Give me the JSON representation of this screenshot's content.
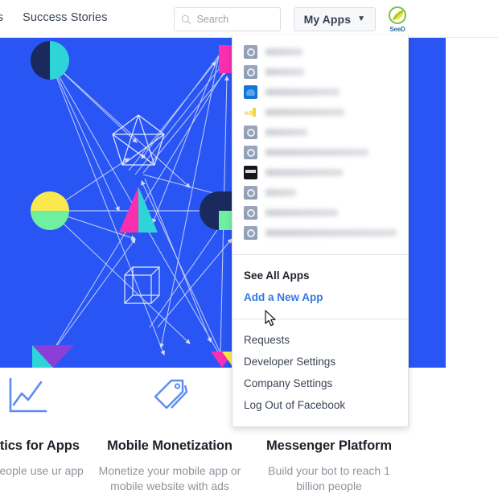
{
  "header": {
    "nav_links": [
      {
        "label": "ews",
        "name": "nav-link-news"
      },
      {
        "label": "Success Stories",
        "name": "nav-link-success-stories"
      }
    ],
    "search": {
      "placeholder": "Search",
      "value": "",
      "icon": "search-icon"
    },
    "my_apps": {
      "label": "My Apps",
      "caret": "▼"
    },
    "logo": {
      "text": "SeeD",
      "icon": "seed-leaf-logo"
    }
  },
  "dropdown": {
    "apps": [
      {
        "icon": "default-app-icon",
        "name_width": 46,
        "redacted": true
      },
      {
        "icon": "default-app-icon",
        "name_width": 48,
        "redacted": true
      },
      {
        "icon": "blue-app-icon",
        "name_width": 92,
        "redacted": true
      },
      {
        "icon": "edu-app-icon",
        "name_width": 98,
        "redacted": true
      },
      {
        "icon": "default-app-icon",
        "name_width": 52,
        "redacted": true
      },
      {
        "icon": "default-app-icon",
        "name_width": 128,
        "redacted": true
      },
      {
        "icon": "dark-app-icon",
        "name_width": 96,
        "redacted": true
      },
      {
        "icon": "default-app-icon",
        "name_width": 38,
        "redacted": true
      },
      {
        "icon": "default-app-icon",
        "name_width": 90,
        "redacted": true
      },
      {
        "icon": "default-app-icon",
        "name_width": 164,
        "redacted": true
      }
    ],
    "apps_section": [
      {
        "label": "See All Apps",
        "style": "strong",
        "name": "see-all-apps"
      },
      {
        "label": "Add a New App",
        "style": "link",
        "name": "add-a-new-app"
      }
    ],
    "account_section": [
      {
        "label": "Requests",
        "name": "requests"
      },
      {
        "label": "Developer Settings",
        "name": "developer-settings"
      },
      {
        "label": "Company Settings",
        "name": "company-settings"
      },
      {
        "label": "Log Out of Facebook",
        "name": "log-out-of-facebook"
      }
    ]
  },
  "hero": {
    "background_color": "#2a55f5",
    "shapes": "network-graph-illustration"
  },
  "cards": [
    {
      "title": "nalytics for Apps",
      "desc": "how people use ur app",
      "icon": "chart-line-icon"
    },
    {
      "title": "Mobile Monetization",
      "desc": "Monetize your mobile app or mobile website with ads",
      "icon": "price-tag-icon"
    },
    {
      "title": "Messenger Platform",
      "desc": "Build your bot to reach 1 billion people",
      "icon": "messenger-icon"
    }
  ],
  "colors": {
    "hero_blue": "#2a55f5",
    "link_blue": "#3578e5",
    "text_dark": "#1d2129",
    "text_muted": "#90949c",
    "card_icon_blue": "#5d8bf4"
  }
}
